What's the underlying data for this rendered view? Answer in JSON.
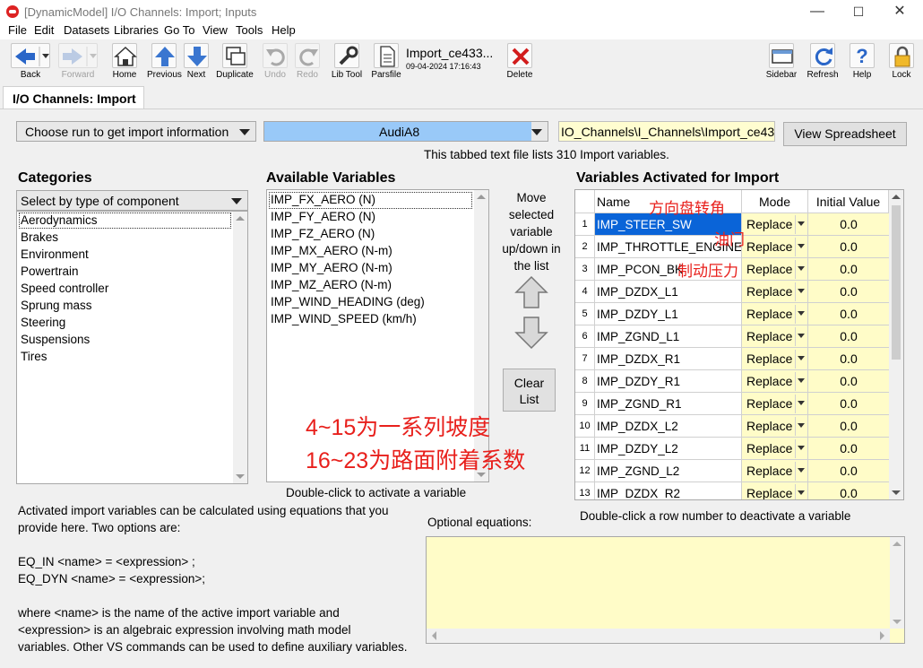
{
  "window": {
    "title": "[DynamicModel] I/O Channels: Import; Inputs",
    "minimize": "—",
    "maximize": "☐",
    "close": "✕"
  },
  "menu": [
    "File",
    "Edit",
    "Datasets",
    "Libraries",
    "Go To",
    "View",
    "Tools",
    "Help"
  ],
  "toolbar": {
    "back": "Back",
    "forward": "Forward",
    "home": "Home",
    "previous": "Previous",
    "next": "Next",
    "duplicate": "Duplicate",
    "undo": "Undo",
    "redo": "Redo",
    "lib_tool": "Lib Tool",
    "parsfile": "Parsfile",
    "dataset_name": "Import_ce433...",
    "dataset_date": "09-04-2024 17:16:43",
    "delete": "Delete",
    "sidebar": "Sidebar",
    "refresh": "Refresh",
    "help": "Help",
    "lock": "Lock"
  },
  "tab": {
    "label": "I/O Channels: Import"
  },
  "top": {
    "run_combo": "Choose run to get import information",
    "vehicle_combo": "AudiA8",
    "file_path": "IO_Channels\\I_Channels\\Import_ce433",
    "view_spreadsheet": "View Spreadsheet",
    "info": "This tabbed text file lists 310 Import variables."
  },
  "categories": {
    "title": "Categories",
    "filter": "Select by type of component",
    "items": [
      "Aerodynamics",
      "Brakes",
      "Environment",
      "Powertrain",
      "Speed controller",
      "Sprung mass",
      "Steering",
      "Suspensions",
      "Tires"
    ]
  },
  "available": {
    "title": "Available Variables",
    "items": [
      "IMP_FX_AERO (N)",
      "IMP_FY_AERO (N)",
      "IMP_FZ_AERO (N)",
      "IMP_MX_AERO (N-m)",
      "IMP_MY_AERO (N-m)",
      "IMP_MZ_AERO (N-m)",
      "IMP_WIND_HEADING (deg)",
      "IMP_WIND_SPEED (km/h)"
    ],
    "hint": "Double-click to activate a variable"
  },
  "move": {
    "label": "Move selected variable up/down in the list",
    "clear": "Clear List"
  },
  "activated": {
    "title": "Variables Activated for Import",
    "columns": [
      "Name",
      "Mode",
      "Initial Value"
    ],
    "rows": [
      {
        "num": "1",
        "name": "IMP_STEER_SW",
        "mode": "Replace",
        "init": "0.0"
      },
      {
        "num": "2",
        "name": "IMP_THROTTLE_ENGINE",
        "mode": "Replace",
        "init": "0.0"
      },
      {
        "num": "3",
        "name": "IMP_PCON_BK",
        "mode": "Replace",
        "init": "0.0"
      },
      {
        "num": "4",
        "name": "IMP_DZDX_L1",
        "mode": "Replace",
        "init": "0.0"
      },
      {
        "num": "5",
        "name": "IMP_DZDY_L1",
        "mode": "Replace",
        "init": "0.0"
      },
      {
        "num": "6",
        "name": "IMP_ZGND_L1",
        "mode": "Replace",
        "init": "0.0"
      },
      {
        "num": "7",
        "name": "IMP_DZDX_R1",
        "mode": "Replace",
        "init": "0.0"
      },
      {
        "num": "8",
        "name": "IMP_DZDY_R1",
        "mode": "Replace",
        "init": "0.0"
      },
      {
        "num": "9",
        "name": "IMP_ZGND_R1",
        "mode": "Replace",
        "init": "0.0"
      },
      {
        "num": "10",
        "name": "IMP_DZDX_L2",
        "mode": "Replace",
        "init": "0.0"
      },
      {
        "num": "11",
        "name": "IMP_DZDY_L2",
        "mode": "Replace",
        "init": "0.0"
      },
      {
        "num": "12",
        "name": "IMP_ZGND_L2",
        "mode": "Replace",
        "init": "0.0"
      },
      {
        "num": "13",
        "name": "IMP_DZDX_R2",
        "mode": "Replace",
        "init": "0.0"
      }
    ],
    "hint": "Double-click a row number to deactivate a variable"
  },
  "annotations": {
    "steer": "方向盘转角",
    "throttle": "油门",
    "brake": "制动压力",
    "slopes": "4~15为一系列坡度",
    "friction": "16~23为路面附着系数"
  },
  "help": {
    "line1": "Activated import variables can be calculated using equations that you",
    "line2": "provide here. Two options are:",
    "eq_in": "EQ_IN <name> = <expression> ;",
    "eq_dyn": "EQ_DYN <name> = <expression>;",
    "line3": "where <name> is the name of the active import variable and",
    "line4": "<expression> is an algebraic expression involving math model",
    "line5": "variables. Other VS commands can be used to define auxiliary variables."
  },
  "equations": {
    "label": "Optional equations:"
  },
  "colors": {
    "selection": "#0a64d8",
    "yellow_cell": "#fffcc8",
    "combo_blue": "#99c9f8",
    "annotation": "#e8201c"
  }
}
